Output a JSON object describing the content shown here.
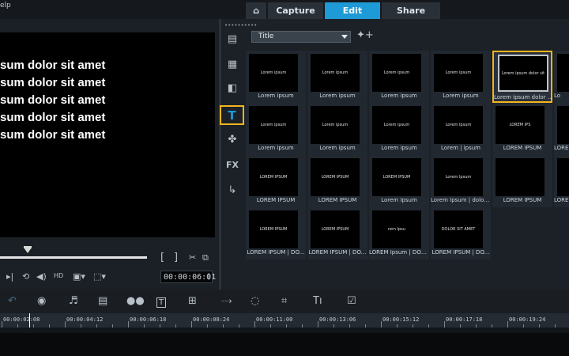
{
  "menu": {
    "help": "elp"
  },
  "tabs": {
    "capture": "Capture",
    "edit": "Edit",
    "share": "Share"
  },
  "preview": {
    "lines": [
      "sum dolor sit amet",
      "sum dolor sit amet",
      "sum dolor sit amet",
      "sum dolor sit amet",
      "sum dolor sit amet"
    ],
    "progress": 0.17,
    "mark_in": "[",
    "mark_out": "]",
    "timecode": "00:00:06:01"
  },
  "library": {
    "category": "Title",
    "side_fx": "FX",
    "side_title": "T",
    "items": [
      {
        "label": "Lorem ipsum",
        "thumb": "Lorem ipsum"
      },
      {
        "label": "Lorem ipsum",
        "thumb": "Lorem ipsum"
      },
      {
        "label": "Lorem ipsum",
        "thumb": "Lorem ipsum"
      },
      {
        "label": "Lorem ipsum",
        "thumb": "Lorem ipsum"
      },
      {
        "label": "Lorem ipsum dolor sit ...",
        "thumb": "Lorem ipsum dolor sit"
      },
      {
        "label": "Lorem ipsum",
        "thumb": "Lorem ipsum"
      },
      {
        "label": "Lorem ipsum",
        "thumb": "Lorem ipsum"
      },
      {
        "label": "Lorem ipsum",
        "thumb": "Lorem ipsum"
      },
      {
        "label": "Lorem | ipsum",
        "thumb": "Lorem Ipsum"
      },
      {
        "label": "LOREM IPSUM",
        "thumb": "LOREM IPS"
      },
      {
        "label": "LOREM IPSUM",
        "thumb": "LOREM IPSUM"
      },
      {
        "label": "LOREM IPSUM",
        "thumb": "LOREM IPSUM"
      },
      {
        "label": "Lorem Ipsum",
        "thumb": "LOREM IPSUM"
      },
      {
        "label": "Lorem Ipsum | dolor s...",
        "thumb": "Lorem Ipsum"
      },
      {
        "label": "LOREM IPSUM",
        "thumb": ""
      },
      {
        "label": "LOREM IPSUM | DO...",
        "thumb": "LOREM IPSUM"
      },
      {
        "label": "LOREM IPSUM | DO...",
        "thumb": "LOREM IPSUM"
      },
      {
        "label": "LOREM Ipsum | DOLO...",
        "thumb": "rem Ipsu"
      },
      {
        "label": "LOREM IPSUM | DO...",
        "thumb": "DOLOR SIT AMET"
      }
    ],
    "partial_labels": [
      "Lo",
      "LOREM",
      "LOREM"
    ]
  },
  "toolbar": {
    "title_tool": "T"
  },
  "ruler": {
    "labels": [
      "00:00:02:08",
      "00:00:04:12",
      "00:00:06:18",
      "00:00:08:24",
      "00:00:11:00",
      "00:00:13:06",
      "00:00:15:12",
      "00:00:17:18",
      "00:00:19:24"
    ]
  },
  "colors": {
    "accent": "#1e9ad6",
    "selection": "#f2b51d"
  }
}
